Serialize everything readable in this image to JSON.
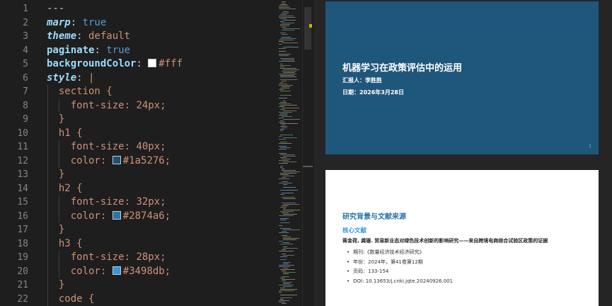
{
  "editor": {
    "line_numbers": [
      "1",
      "2",
      "3",
      "4",
      "5",
      "6",
      "7",
      "8",
      "9",
      "10",
      "11",
      "12",
      "13",
      "14",
      "15",
      "16",
      "17",
      "18",
      "19",
      "20",
      "21",
      "22"
    ],
    "lines": {
      "l1": "---",
      "l2_key": "marp",
      "l2_val": "true",
      "l3_key": "theme",
      "l3_val": "default",
      "l4_key": "paginate",
      "l4_val": "true",
      "l5_key": "backgroundColor",
      "l5_val": "#fff",
      "l6_key": "style",
      "l6_val": "|",
      "l7_sel": "section",
      "l8_prop": "font-size",
      "l8_val": "24px",
      "l10_sel": "h1",
      "l11_prop": "font-size",
      "l11_val": "40px",
      "l12_prop": "color",
      "l12_val": "#1a5276",
      "l14_sel": "h2",
      "l15_prop": "font-size",
      "l15_val": "32px",
      "l16_prop": "color",
      "l16_val": "#2874a6",
      "l18_sel": "h3",
      "l19_prop": "font-size",
      "l19_val": "28px",
      "l20_prop": "color",
      "l20_val": "#3498db",
      "l22_sel": "code"
    },
    "swatch_colors": {
      "bg": "#ffffff",
      "h1": "#1a5276",
      "h2": "#2874a6",
      "h3": "#3498db"
    }
  },
  "preview": {
    "slide1": {
      "title": "机器学习在政策评估中的运用",
      "reporter": "汇报人：李胜胜",
      "date": "日期：2026年3月28日",
      "page_number": "1",
      "background": "#1f567b"
    },
    "slide2": {
      "heading": "研究背景与文献来源",
      "subheading": "核心文献",
      "reference": "蒋金荷, 龚珊. 贸易新业态对绿色技术创新的影响研究——来自跨境电商综合试验区政策的证据",
      "items": [
        "期刊:《数量经济技术经济研究》",
        "年份：2024年，第41卷第12期",
        "页码：133-154",
        "DOI: 10.13653/j.cnki.jqte.20240926.001"
      ]
    }
  }
}
